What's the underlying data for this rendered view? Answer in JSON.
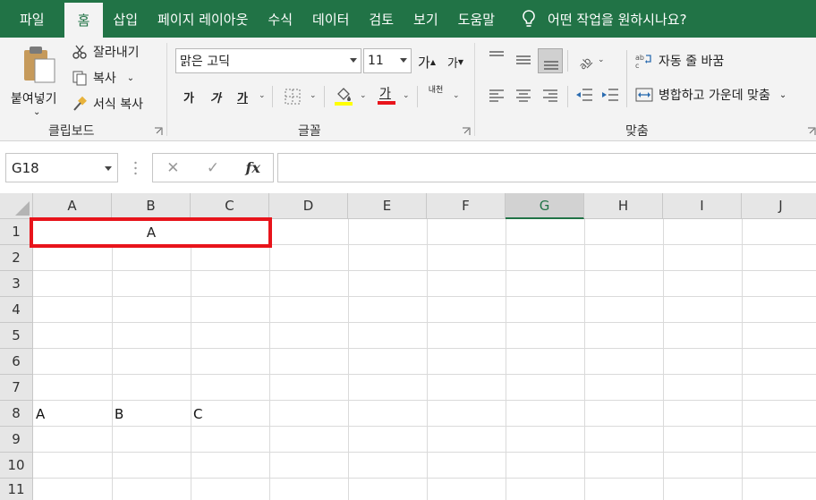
{
  "tabs": [
    "파일",
    "홈",
    "삽입",
    "페이지 레이아웃",
    "수식",
    "데이터",
    "검토",
    "보기",
    "도움말"
  ],
  "active_tab": "홈",
  "tell_me": "어떤 작업을 원하시나요?",
  "clipboard": {
    "paste": "붙여넣기",
    "cut": "잘라내기",
    "copy": "복사",
    "format_painter": "서식 복사",
    "label": "클립보드"
  },
  "font": {
    "name": "맑은 고딕",
    "size": "11",
    "grow": "가",
    "shrink": "가",
    "bold": "가",
    "italic": "가",
    "underline": "가",
    "font_color": "가",
    "phonetic": "내천",
    "label": "글꼴",
    "fill_color": "#ffff00",
    "text_color": "#e8141b"
  },
  "alignment": {
    "wrap_text": "자동 줄 바꿈",
    "merge_center": "병합하고 가운데 맞춤",
    "label": "맞춤"
  },
  "formula_bar": {
    "name_box": "G18",
    "cancel": "✕",
    "enter": "✓",
    "fx": "fx",
    "value": ""
  },
  "columns": [
    "A",
    "B",
    "C",
    "D",
    "E",
    "F",
    "G",
    "H",
    "I",
    "J"
  ],
  "selected_column": "G",
  "rows": [
    "1",
    "2",
    "3",
    "4",
    "5",
    "6",
    "7",
    "8",
    "9",
    "10",
    "11"
  ],
  "cells": {
    "merged_A1_C1": "A",
    "A8": "A",
    "B8": "B",
    "C8": "C"
  },
  "colors": {
    "excel_green": "#217346",
    "highlight_red": "#e8141b"
  }
}
